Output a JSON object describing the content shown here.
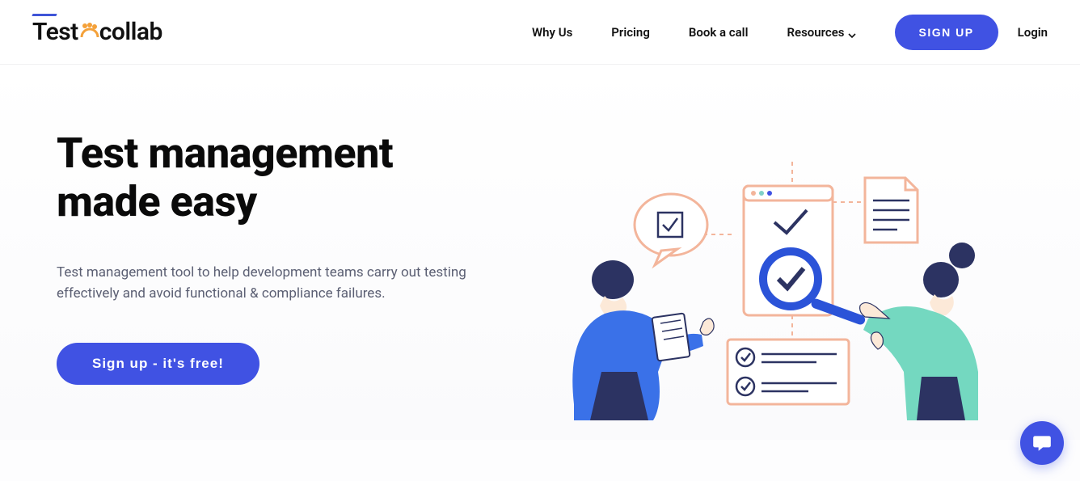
{
  "logo": {
    "text1": "Test",
    "text2": "collab"
  },
  "nav": {
    "why_us": "Why Us",
    "pricing": "Pricing",
    "book_call": "Book a call",
    "resources": "Resources",
    "signup": "SIGN UP",
    "login": "Login"
  },
  "hero": {
    "title_line1": "Test management",
    "title_line2": "made easy",
    "subtitle": "Test management tool to help development teams carry out testing effectively and avoid functional & compliance failures.",
    "cta": "Sign up - it's free!"
  }
}
